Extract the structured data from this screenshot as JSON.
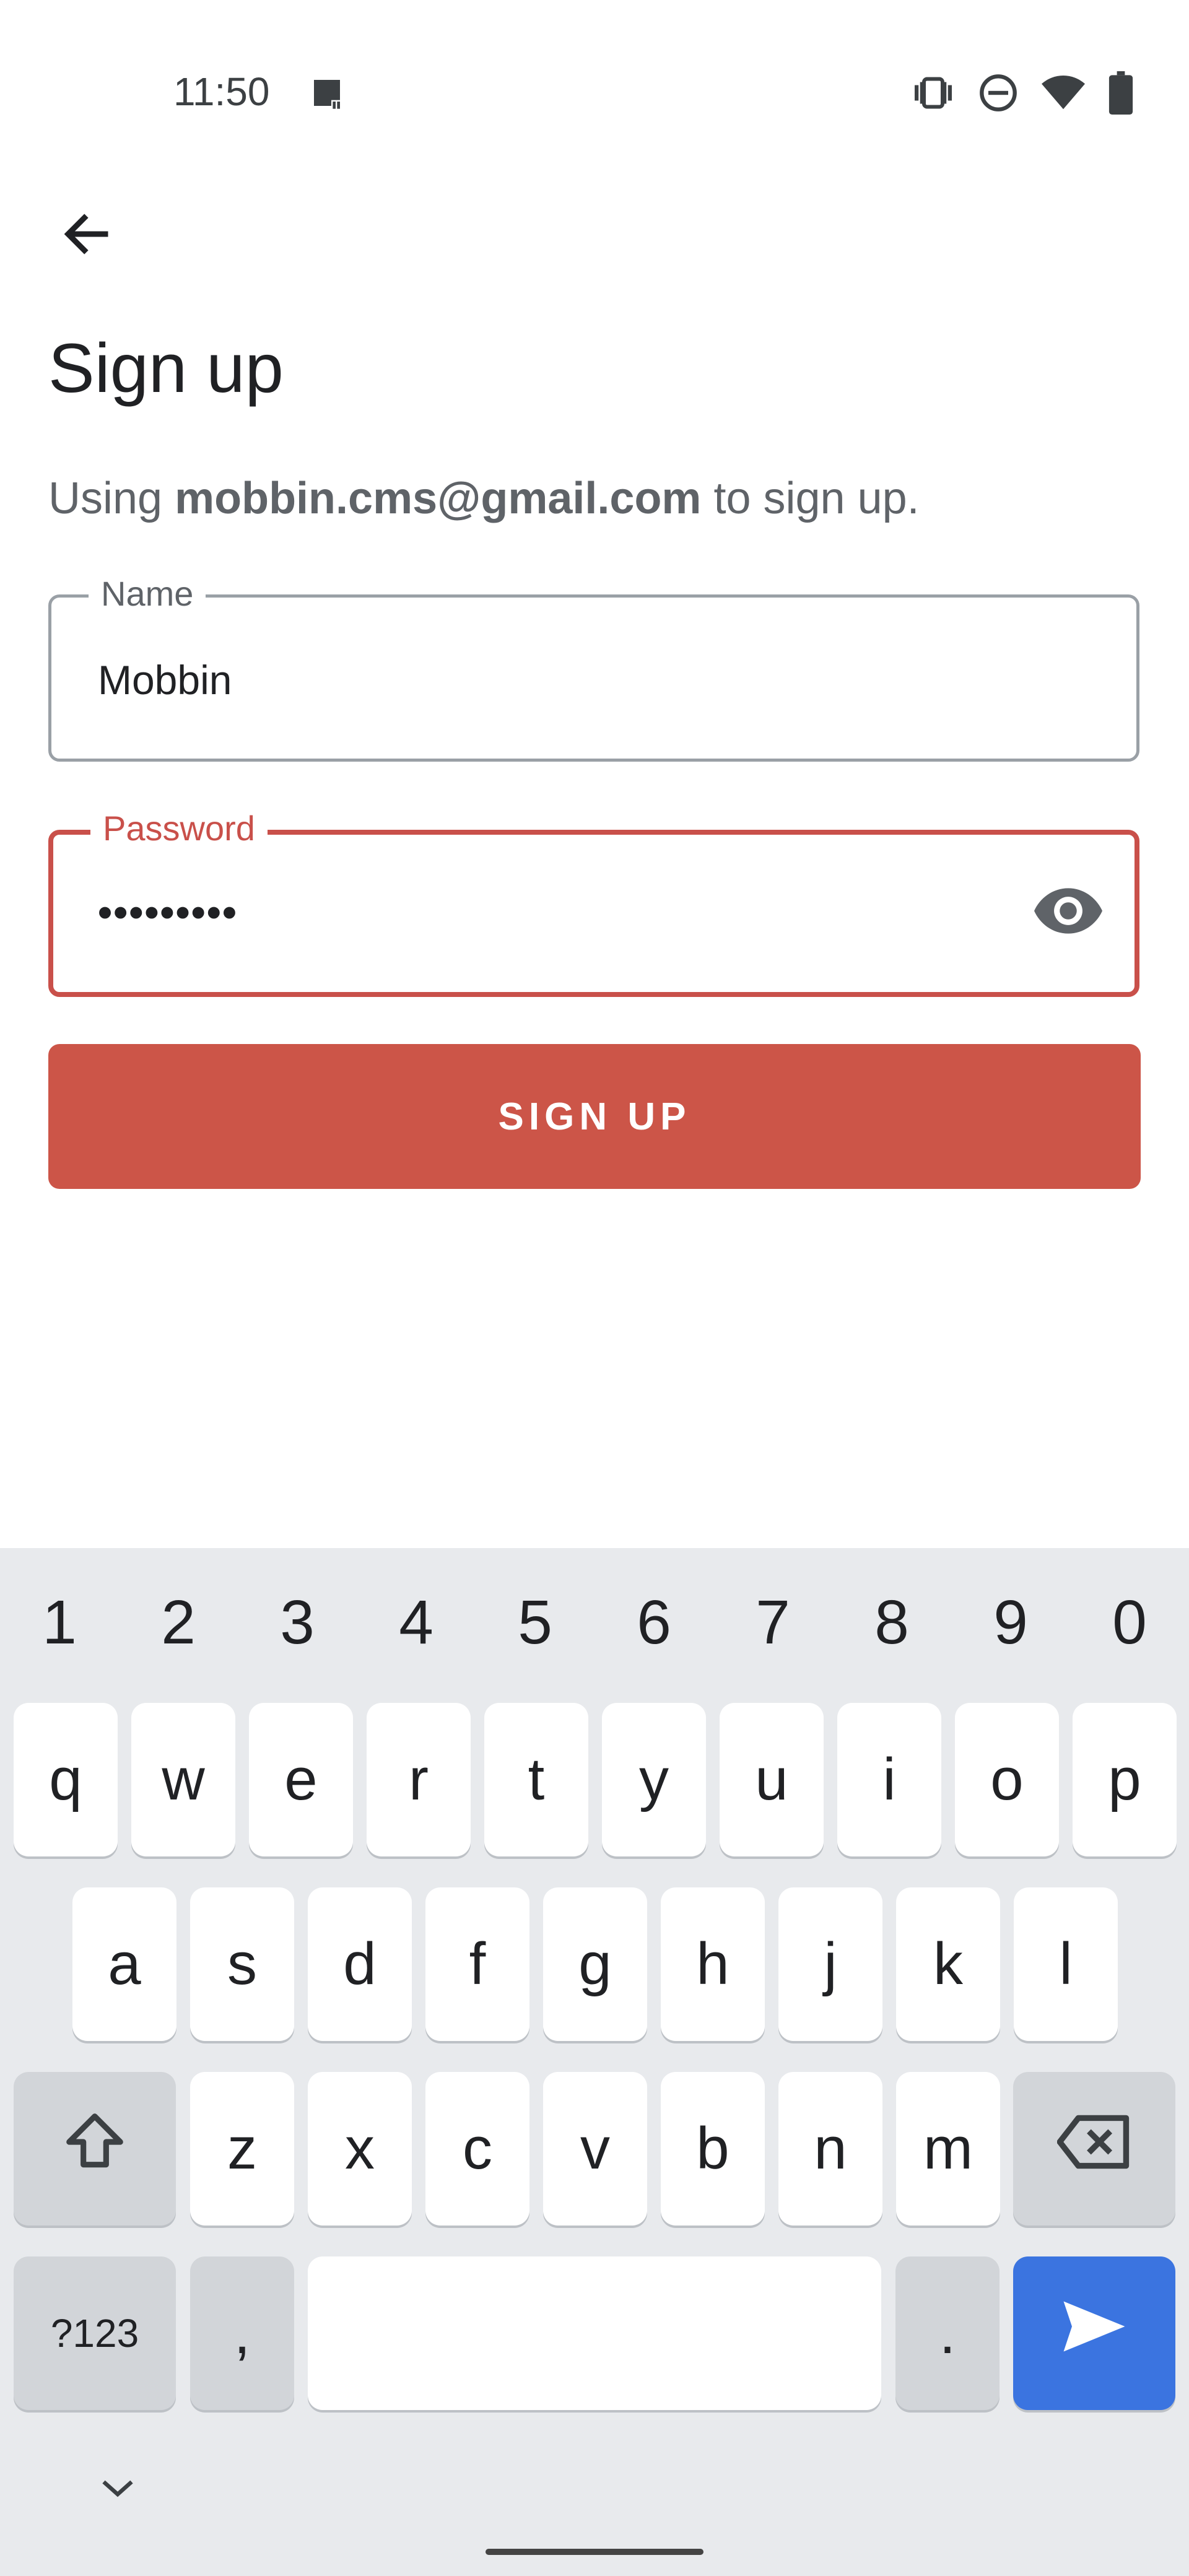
{
  "status_bar": {
    "time": "11:50",
    "icons": [
      "image-icon",
      "vibrate-icon",
      "do-not-disturb-icon",
      "wifi-icon",
      "battery-icon"
    ]
  },
  "header": {
    "back_icon": "arrow-left-icon"
  },
  "title": "Sign up",
  "subtitle": {
    "prefix": "Using ",
    "email": "mobbin.cms@gmail.com",
    "suffix": " to sign up."
  },
  "form": {
    "name": {
      "label": "Name",
      "value": "Mobbin"
    },
    "password": {
      "label": "Password",
      "value": "•••••••••",
      "toggle_icon": "eye-icon"
    },
    "submit_label": "SIGN UP"
  },
  "colors": {
    "accent": "#cc5548",
    "keyboard_bg": "#e8eaed",
    "send_key": "#3b74e0"
  },
  "keyboard": {
    "numbers": [
      "1",
      "2",
      "3",
      "4",
      "5",
      "6",
      "7",
      "8",
      "9",
      "0"
    ],
    "row1": [
      "q",
      "w",
      "e",
      "r",
      "t",
      "y",
      "u",
      "i",
      "o",
      "p"
    ],
    "row2": [
      "a",
      "s",
      "d",
      "f",
      "g",
      "h",
      "j",
      "k",
      "l"
    ],
    "row3": [
      "z",
      "x",
      "c",
      "v",
      "b",
      "n",
      "m"
    ],
    "symbols_label": "?123",
    "comma": ",",
    "period": ".",
    "shift_icon": "shift-icon",
    "backspace_icon": "backspace-icon",
    "send_icon": "send-icon",
    "collapse_icon": "chevron-down-icon"
  }
}
